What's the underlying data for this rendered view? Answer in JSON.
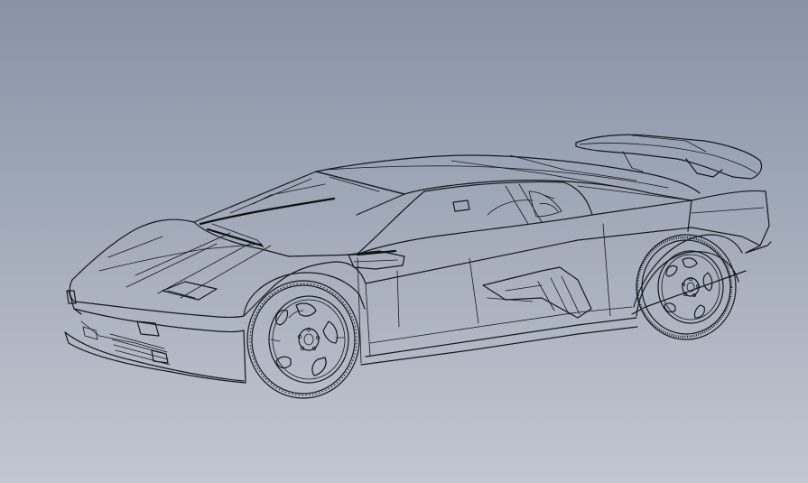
{
  "scene": {
    "subject": "car-wireframe-model",
    "view": "front-three-quarter",
    "render_style": "black-edge-lines-on-gradient",
    "colors": {
      "background_top": "#8793a6",
      "background_bottom": "#c2c6d0",
      "edge_line": "#15181d"
    }
  }
}
